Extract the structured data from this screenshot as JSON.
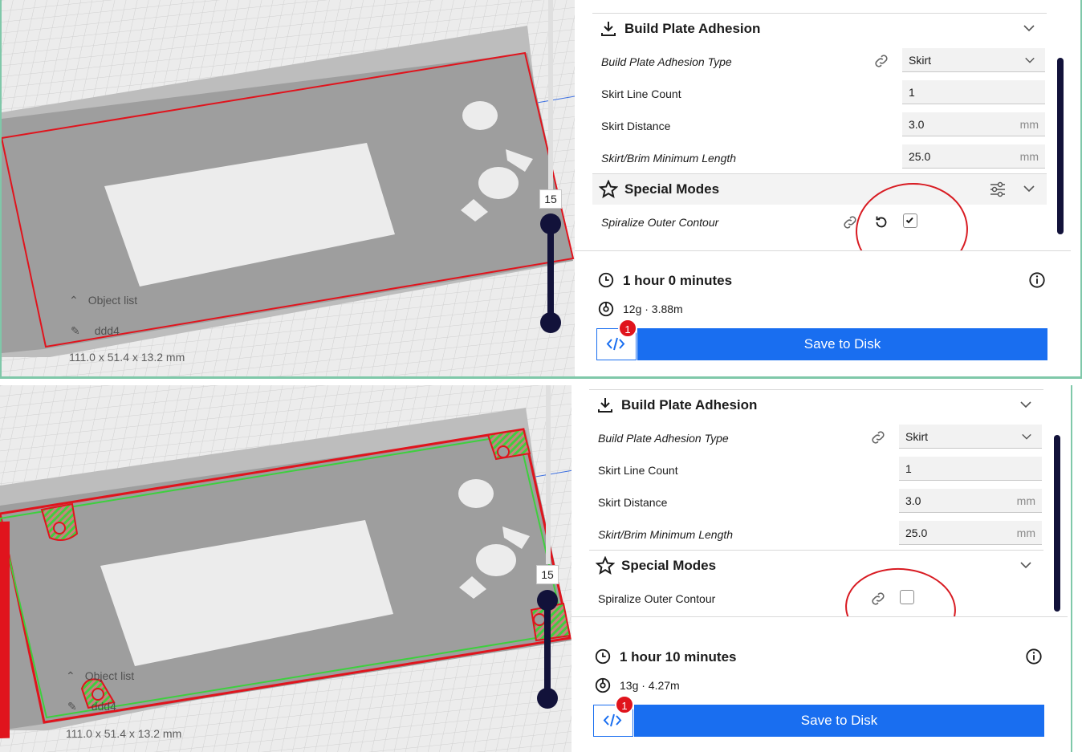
{
  "colors": {
    "accent": "#196ef0",
    "dark_navy": "#12123a",
    "annotation_red": "#d81b22",
    "frame_green": "#7fc8a9",
    "model_grey": "#9a9a9a",
    "skirt_red": "#e0141d",
    "support_green": "#3ecf3e"
  },
  "top": {
    "layer_number": "15",
    "object_list_label": "Object list",
    "object_name": "ddd4",
    "dimensions": "111.0 x 51.4 x 13.2 mm",
    "adhesion": {
      "title": "Build Plate Adhesion",
      "type_label": "Build Plate Adhesion Type",
      "type_value": "Skirt",
      "skirt_line_count_label": "Skirt Line Count",
      "skirt_line_count_value": "1",
      "skirt_distance_label": "Skirt Distance",
      "skirt_distance_value": "3.0",
      "skirt_distance_unit": "mm",
      "min_length_label": "Skirt/Brim Minimum Length",
      "min_length_value": "25.0",
      "min_length_unit": "mm"
    },
    "special": {
      "title": "Special Modes",
      "spiralize_label": "Spiralize Outer Contour",
      "spiralize_checked": true
    },
    "summary": {
      "time": "1 hour 0 minutes",
      "material": "12g · 3.88m",
      "badge": "1",
      "save_label": "Save to Disk"
    }
  },
  "bottom": {
    "layer_number": "15",
    "object_list_label": "Object list",
    "object_name": "ddd4",
    "dimensions": "111.0 x 51.4 x 13.2 mm",
    "adhesion": {
      "title": "Build Plate Adhesion",
      "type_label": "Build Plate Adhesion Type",
      "type_value": "Skirt",
      "skirt_line_count_label": "Skirt Line Count",
      "skirt_line_count_value": "1",
      "skirt_distance_label": "Skirt Distance",
      "skirt_distance_value": "3.0",
      "skirt_distance_unit": "mm",
      "min_length_label": "Skirt/Brim Minimum Length",
      "min_length_value": "25.0",
      "min_length_unit": "mm"
    },
    "special": {
      "title": "Special Modes",
      "spiralize_label": "Spiralize Outer Contour",
      "spiralize_checked": false
    },
    "summary": {
      "time": "1 hour 10 minutes",
      "material": "13g · 4.27m",
      "badge": "1",
      "save_label": "Save to Disk"
    }
  }
}
